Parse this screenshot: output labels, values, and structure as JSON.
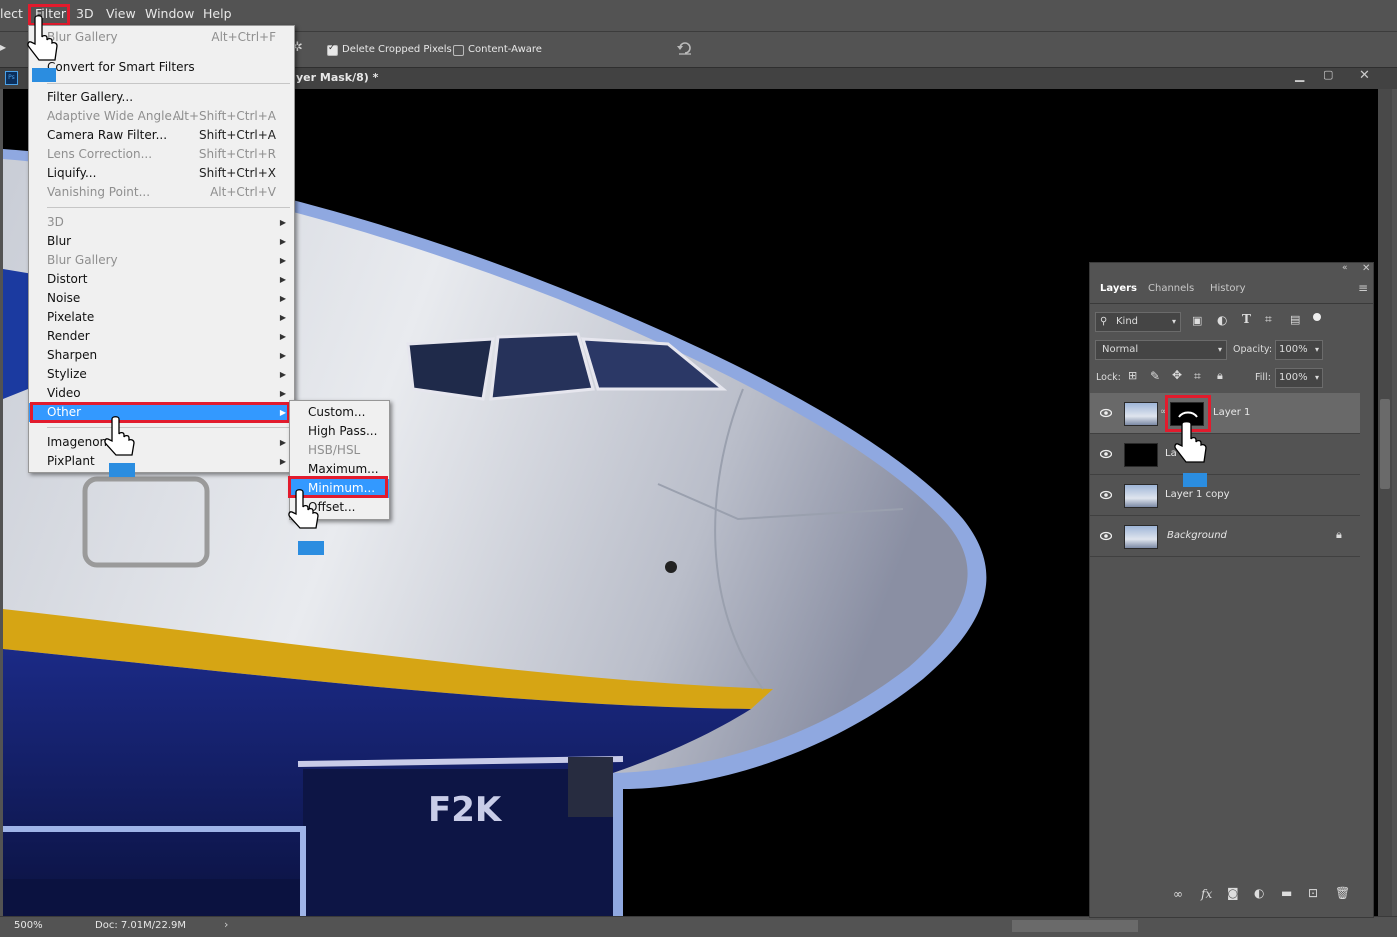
{
  "menubar": {
    "items": [
      {
        "label": "lect"
      },
      {
        "label": "Filter"
      },
      {
        "label": "3D"
      },
      {
        "label": "View"
      },
      {
        "label": "Window"
      },
      {
        "label": "Help"
      }
    ]
  },
  "options_bar": {
    "delete_cropped_label": "Delete Cropped Pixels",
    "delete_cropped_checked": true,
    "content_aware_label": "Content-Aware",
    "content_aware_checked": false
  },
  "document": {
    "tab_title": "yer Mask/8) *",
    "zoom": "500%",
    "doc_info": "Doc: 7.01M/22.9M",
    "canvas_text": "F2K"
  },
  "filter_menu": {
    "items": [
      {
        "label": "Blur Gallery",
        "shortcut": "Alt+Ctrl+F",
        "disabled": true
      },
      {
        "label": "Convert for Smart Filters",
        "shortcut": "",
        "disabled": false
      },
      {
        "label": "Filter Gallery...",
        "shortcut": "",
        "disabled": false
      },
      {
        "label": "Adaptive Wide Angle...",
        "shortcut": "Alt+Shift+Ctrl+A",
        "disabled": true
      },
      {
        "label": "Camera Raw Filter...",
        "shortcut": "Shift+Ctrl+A",
        "disabled": false
      },
      {
        "label": "Lens Correction...",
        "shortcut": "Shift+Ctrl+R",
        "disabled": true
      },
      {
        "label": "Liquify...",
        "shortcut": "Shift+Ctrl+X",
        "disabled": false
      },
      {
        "label": "Vanishing Point...",
        "shortcut": "Alt+Ctrl+V",
        "disabled": true
      },
      {
        "label": "3D",
        "disabled": true
      },
      {
        "label": "Blur",
        "disabled": false
      },
      {
        "label": "Blur Gallery",
        "disabled": true
      },
      {
        "label": "Distort",
        "disabled": false
      },
      {
        "label": "Noise",
        "disabled": false
      },
      {
        "label": "Pixelate",
        "disabled": false
      },
      {
        "label": "Render",
        "disabled": false
      },
      {
        "label": "Sharpen",
        "disabled": false
      },
      {
        "label": "Stylize",
        "disabled": false
      },
      {
        "label": "Video",
        "disabled": false
      },
      {
        "label": "Other",
        "disabled": false,
        "highlighted": true
      },
      {
        "label": "Imagenomic",
        "disabled": false
      },
      {
        "label": "PixPlant",
        "disabled": false
      }
    ]
  },
  "other_submenu": {
    "items": [
      {
        "label": "Custom...",
        "disabled": false
      },
      {
        "label": "High Pass...",
        "disabled": false
      },
      {
        "label": "HSB/HSL",
        "disabled": true
      },
      {
        "label": "Maximum...",
        "disabled": false
      },
      {
        "label": "Minimum...",
        "disabled": false,
        "highlighted": true
      },
      {
        "label": "Offset...",
        "disabled": false
      }
    ]
  },
  "layers_panel": {
    "tabs": [
      {
        "label": "Layers",
        "active": true
      },
      {
        "label": "Channels",
        "active": false
      },
      {
        "label": "History",
        "active": false
      }
    ],
    "filter_kind": "Kind",
    "blend_mode": "Normal",
    "opacity_label": "Opacity:",
    "opacity_value": "100%",
    "lock_label": "Lock:",
    "fill_label": "Fill:",
    "fill_value": "100%",
    "layers": [
      {
        "name": "Layer 1",
        "selected": true,
        "has_mask": true
      },
      {
        "name": "La",
        "selected": false,
        "has_mask": false
      },
      {
        "name": "Layer 1 copy",
        "selected": false,
        "has_mask": false
      },
      {
        "name": "Background",
        "selected": false,
        "has_mask": false,
        "locked": true
      }
    ]
  },
  "colors": {
    "highlight": "#3399ff",
    "annotation_red": "#e21b2d",
    "hand_marker_blue": "#2b8de0"
  }
}
